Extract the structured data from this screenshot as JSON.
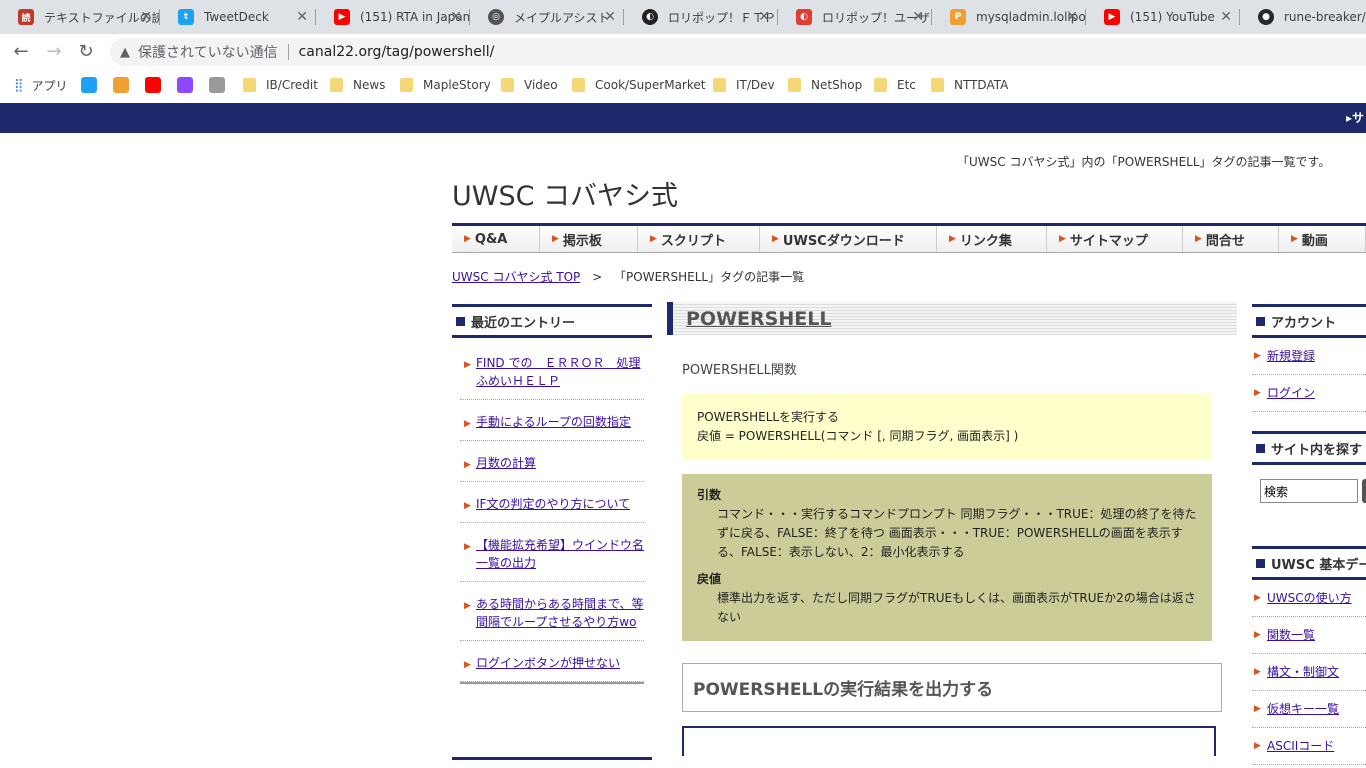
{
  "browser": {
    "tabs": [
      {
        "label": "テキストファイルの読",
        "color": "#c0392b",
        "icon": "site-icon"
      },
      {
        "label": "TweetDeck",
        "color": "#1da1f2",
        "icon": "twitter-icon"
      },
      {
        "label": "(151) RTA in Japan",
        "color": "#ff0000",
        "icon": "youtube-icon"
      },
      {
        "label": "メイプルアシスト",
        "color": "#555555",
        "icon": "globe-icon"
      },
      {
        "label": "ロリポップ！ＦＴＰ",
        "color": "#222222",
        "icon": "lolipop-icon"
      },
      {
        "label": "ロリポップ！ユーザー",
        "color": "#e03c31",
        "icon": "lolipop-icon"
      },
      {
        "label": "mysqladmin.lolipo",
        "color": "#f0a030",
        "icon": "phpmyadmin-icon"
      },
      {
        "label": "(151) YouTube",
        "color": "#ff0000",
        "icon": "youtube-icon"
      },
      {
        "label": "rune-breaker/RE",
        "color": "#24292e",
        "icon": "github-icon"
      }
    ],
    "insecure_label": "保護されていない通信",
    "url": "canal22.org/tag/powershell/"
  },
  "bookmarks": {
    "apps_label": "アプリ",
    "folders": [
      "IB/Credit",
      "News",
      "MapleStory",
      "Video",
      "Cook/SuperMarket",
      "IT/Dev",
      "NetShop",
      "Etc",
      "NTTDATA"
    ]
  },
  "site": {
    "description": "「UWSC コバヤシ式」内の「POWERSHELL」タグの記事一覧です。",
    "title": "UWSC コバヤシ式",
    "nav": [
      "Q&A",
      "掲示板",
      "スクリプト",
      "UWSCダウンロード",
      "リンク集",
      "サイトマップ",
      "問合せ",
      "動画"
    ],
    "breadcrumb": {
      "home": "UWSC コバヤシ式 TOP",
      "sep": ">",
      "current": "「POWERSHELL」タグの記事一覧"
    }
  },
  "left_sidebar": {
    "heading": "最近のエントリー",
    "entries": [
      "FIND での　ＥＲＲＯＲ　処理ふめいＨＥＬＰ",
      "手動によるループの回数指定",
      "月数の計算",
      "IF文の判定のやり方について",
      "【機能拡充希望】ウインドウ名一覧の出力",
      "ある時間からある時間まで、等間隔でループさせるやり方wo",
      "ログインボタンが押せない"
    ]
  },
  "main": {
    "heading": "POWERSHELL",
    "subtitle": "POWERSHELL関数",
    "syntax_line1": "POWERSHELLを実行する",
    "syntax_line2": "戻値 = POWERSHELL(コマンド [, 同期フラグ, 画面表示] )",
    "args_label": "引数",
    "args_text": "コマンド・・・実行するコマンドプロンプト 同期フラグ・・・TRUE：処理の終了を待たずに戻る、FALSE：終了を待つ 画面表示・・・TRUE：POWERSHELLの画面を表示する、FALSE：表示しない、2：最小化表示する",
    "return_label": "戻値",
    "return_text": "標準出力を返す、ただし同期フラグがTRUEもしくは、画面表示がTRUEか2の場合は返さない",
    "section_title": "POWERSHELLの実行結果を出力する"
  },
  "right_sidebar": {
    "account_heading": "アカウント",
    "account_links": [
      "新規登録",
      "ログイン"
    ],
    "search_heading": "サイト内を探す",
    "search_value": "検索",
    "basics_heading": "UWSC 基本データ",
    "basics_links": [
      "UWSCの使い方",
      "関数一覧",
      "構文・制御文",
      "仮想キー一覧",
      "ASCIIコード"
    ]
  },
  "colors": {
    "brand_navy": "#1c2a6b",
    "accent_orange": "#d9531e",
    "syntax_bg": "#ffffcc",
    "args_bg": "#cccc99"
  }
}
